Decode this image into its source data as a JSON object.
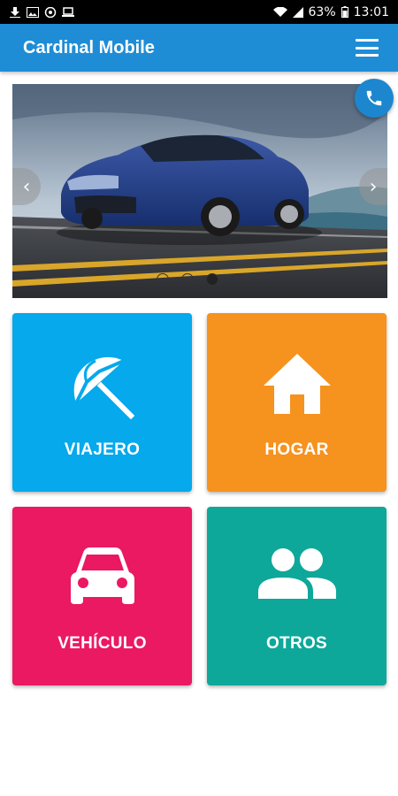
{
  "status_bar": {
    "battery": "63%",
    "time": "13:01"
  },
  "app_bar": {
    "title": "Cardinal Mobile",
    "menu_icon": "hamburger-menu-icon"
  },
  "carousel": {
    "image": "blue-sedan-on-road",
    "slides_total": 4,
    "active_slide": 3
  },
  "categories": [
    {
      "label": "VIAJERO",
      "icon": "beach-umbrella-icon",
      "color": "#05a9ec"
    },
    {
      "label": "HOGAR",
      "icon": "house-icon",
      "color": "#f6921e"
    },
    {
      "label": "VEHÍCULO",
      "icon": "car-icon",
      "color": "#eb1862"
    },
    {
      "label": "OTROS",
      "icon": "people-icon",
      "color": "#0ea89a"
    }
  ],
  "colors": {
    "app_bar": "#1f8dd6",
    "call_button": "#1c87cf"
  }
}
